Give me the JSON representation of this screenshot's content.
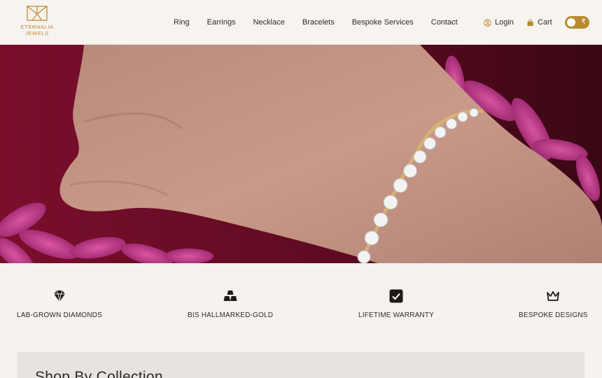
{
  "brand": {
    "name_line1": "ETERNALIA",
    "name_line2": "JEWELS",
    "accent_color": "#b98a2e"
  },
  "nav": {
    "items": [
      "Ring",
      "Earrings",
      "Necklace",
      "Bracelets",
      "Bespoke Services",
      "Contact"
    ]
  },
  "account": {
    "login_label": "Login",
    "cart_label": "Cart",
    "currency_symbol": "₹",
    "login_icon": "user-circle-icon",
    "cart_icon": "shopping-bag-icon"
  },
  "features": [
    {
      "icon": "diamond-icon",
      "label": "LAB-GROWN DIAMONDS"
    },
    {
      "icon": "gold-bars-icon",
      "label": "BIS HALLMARKED-GOLD"
    },
    {
      "icon": "check-badge-icon",
      "label": "LIFETIME WARRANTY"
    },
    {
      "icon": "crown-icon",
      "label": "BESPOKE DESIGNS"
    }
  ],
  "collection": {
    "title": "Shop By Collection"
  }
}
